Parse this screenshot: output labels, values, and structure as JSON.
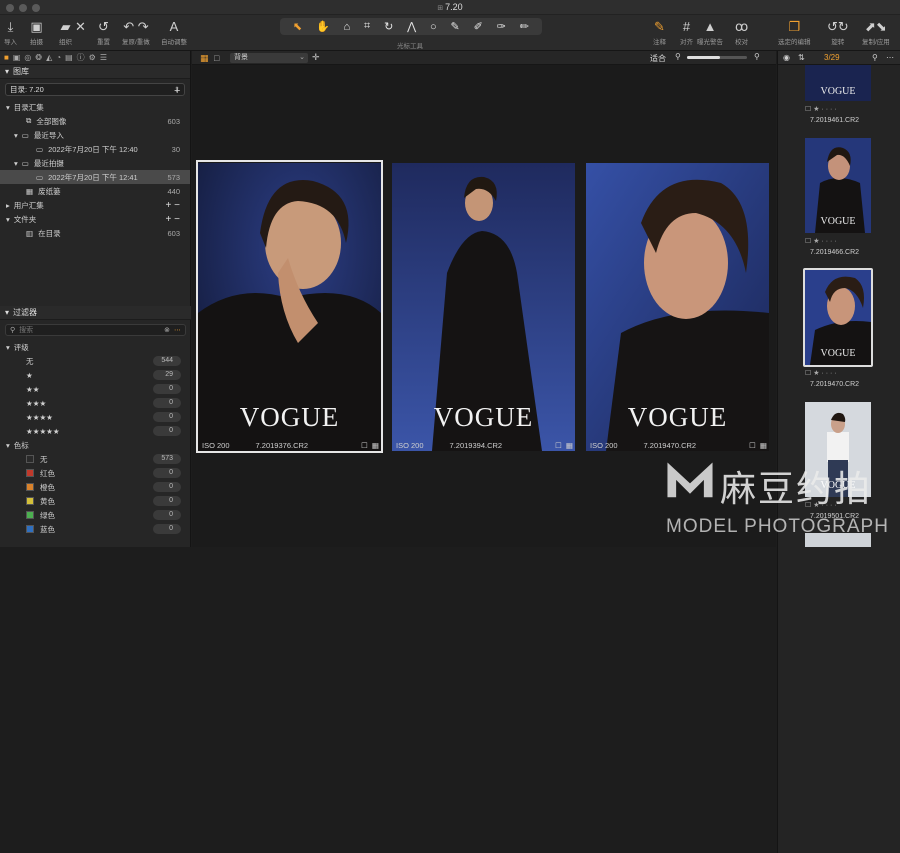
{
  "window": {
    "title": "7.20"
  },
  "toolbar": {
    "left": [
      {
        "icon": "import-icon",
        "label": "导入"
      },
      {
        "icon": "camera-icon",
        "label": "拍摄"
      },
      {
        "icon": "folder-icon",
        "label": "组织"
      },
      {
        "icon": "delete-icon",
        "label": ""
      },
      {
        "icon": "reset-icon",
        "label": "重置"
      },
      {
        "icon": "undo-icon",
        "label": "复原/重做"
      },
      {
        "icon": "auto-adjust-icon",
        "label": "自动调整"
      }
    ],
    "cursor_tools_label": "光标工具",
    "right": [
      {
        "icon": "annotate-icon",
        "label": "注释"
      },
      {
        "icon": "grid-icon",
        "label": "对齐"
      },
      {
        "icon": "warning-icon",
        "label": "曝光警告"
      },
      {
        "icon": "glasses-icon",
        "label": "校对"
      },
      {
        "icon": "layers-icon",
        "label": "选定的编辑"
      },
      {
        "icon": "rotate-icon",
        "label": "旋转"
      },
      {
        "icon": "export-icon",
        "label": "复制/应用"
      }
    ]
  },
  "library": {
    "title": "图库",
    "catalog": "目录: 7.20",
    "section": "目录汇集",
    "items": [
      {
        "label": "全部图像",
        "count": "603"
      },
      {
        "label": "最近导入",
        "count": ""
      },
      {
        "label": "2022年7月20日 下午 12:40",
        "count": "30"
      },
      {
        "label": "最近拍摄",
        "count": ""
      },
      {
        "label": "2022年7月20日 下午 12:41",
        "count": "573"
      },
      {
        "label": "废纸篓",
        "count": "440"
      }
    ],
    "user_collections": "用户汇集",
    "folders": "文件夹",
    "in_catalog": "在目录",
    "in_catalog_count": "603"
  },
  "filters": {
    "title": "过滤器",
    "search_placeholder": "搜索",
    "rating_title": "评级",
    "ratings": [
      {
        "label": "无",
        "count": "544"
      },
      {
        "label": "★",
        "count": "29"
      },
      {
        "label": "★★",
        "count": "0"
      },
      {
        "label": "★★★",
        "count": "0"
      },
      {
        "label": "★★★★",
        "count": "0"
      },
      {
        "label": "★★★★★",
        "count": "0"
      }
    ],
    "color_title": "色标",
    "colors": [
      {
        "label": "无",
        "count": "573",
        "color": "#2a2a2a"
      },
      {
        "label": "红色",
        "count": "0",
        "color": "#c0392b"
      },
      {
        "label": "橙色",
        "count": "0",
        "color": "#d9822b"
      },
      {
        "label": "黄色",
        "count": "0",
        "color": "#d4c03a"
      },
      {
        "label": "绿色",
        "count": "0",
        "color": "#4caf50"
      },
      {
        "label": "蓝色",
        "count": "0",
        "color": "#2f6fbf"
      }
    ]
  },
  "viewer": {
    "background_select": "背景",
    "fit_label": "适合",
    "photos": [
      {
        "iso": "ISO 200",
        "file": "7.2019376.CR2",
        "text": "VOGUE"
      },
      {
        "iso": "ISO 200",
        "file": "7.2019394.CR2",
        "text": "VOGUE"
      },
      {
        "iso": "ISO 200",
        "file": "7.2019470.CR2",
        "text": "VOGUE"
      }
    ]
  },
  "browser": {
    "counter": "3/29",
    "thumbs": [
      {
        "file": "7.2019461.CR2",
        "text": "VOGUE"
      },
      {
        "file": "7.2019466.CR2",
        "text": "VOGUE"
      },
      {
        "file": "7.2019470.CR2",
        "text": "VOGUE"
      },
      {
        "file": "7.2019501.CR2",
        "text": "VOGUE"
      }
    ]
  },
  "watermark": {
    "brand": "麻豆约拍",
    "sub": "MODEL PHOTOGRAPH"
  }
}
